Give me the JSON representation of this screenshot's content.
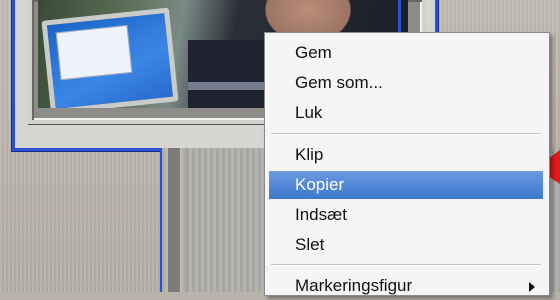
{
  "background": {
    "accent_blue": "#2d4fd6",
    "menu_highlight": "#4a82d8",
    "arrow_red": "#e11b1b"
  },
  "context_menu": {
    "items": [
      {
        "label": "Gem"
      },
      {
        "label": "Gem som..."
      },
      {
        "label": "Luk"
      },
      {
        "label": "Klip"
      },
      {
        "label": "Kopier",
        "selected": true
      },
      {
        "label": "Indsæt"
      },
      {
        "label": "Slet"
      },
      {
        "label": "Markeringsfigur",
        "has_submenu": true
      }
    ]
  },
  "icons": {
    "submenu": "chevron-right-icon",
    "pointer": "red-arrow-icon"
  }
}
